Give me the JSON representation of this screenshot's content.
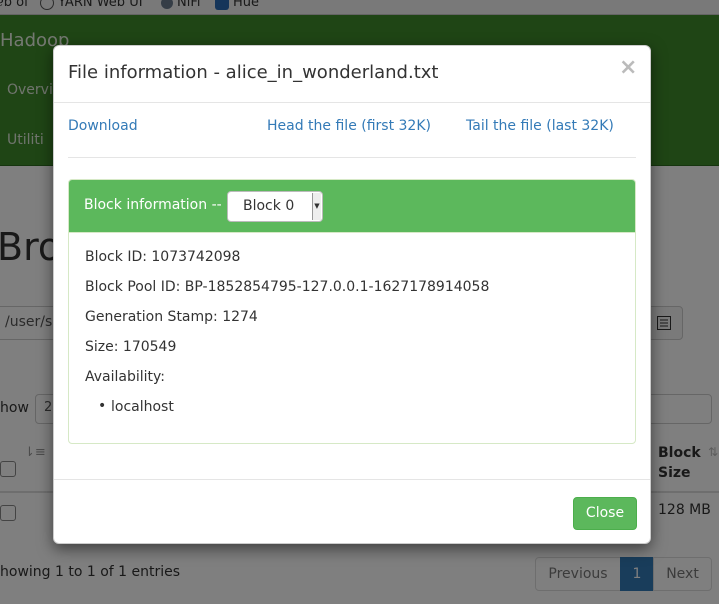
{
  "bookmarks": [
    {
      "label": "ℯb of",
      "icon": "globe-icon"
    },
    {
      "label": "YARN Web UI",
      "icon": "globe-icon"
    },
    {
      "label": "NiFi",
      "icon": "nifi-icon"
    },
    {
      "label": "Hue",
      "icon": "hue-icon"
    }
  ],
  "background": {
    "brand": "Hadoop",
    "nav_overview": "Overvi",
    "nav_utilities": "Utiliti",
    "page_title": "Bro",
    "path_value": "/user/s",
    "show_label": "how",
    "show_value": "2",
    "block_size_header": "Block Size",
    "row_block_size": "128 MB",
    "showing_text": "howing 1 to 1 of 1 entries",
    "pagination": {
      "previous": "Previous",
      "current": "1",
      "next": "Next"
    }
  },
  "modal": {
    "title": "File information - alice_in_wonderland.txt",
    "close_symbol": "×",
    "links": {
      "download": "Download",
      "head": "Head the file (first 32K)",
      "tail": "Tail the file (last 32K)"
    },
    "block_heading": "Block information --",
    "block_select": "Block 0",
    "block_id": "Block ID: 1073742098",
    "block_pool_id": "Block Pool ID: BP-1852854795-127.0.0.1-1627178914058",
    "generation_stamp": "Generation Stamp: 1274",
    "size": "Size: 170549",
    "availability_label": "Availability:",
    "availability_hosts": [
      "localhost"
    ],
    "close_button": "Close"
  },
  "colors": {
    "navbar_green": "#3f8b2b",
    "panel_green": "#5cb85c",
    "link_blue": "#337ab7",
    "active_page_blue": "#337ab7"
  }
}
